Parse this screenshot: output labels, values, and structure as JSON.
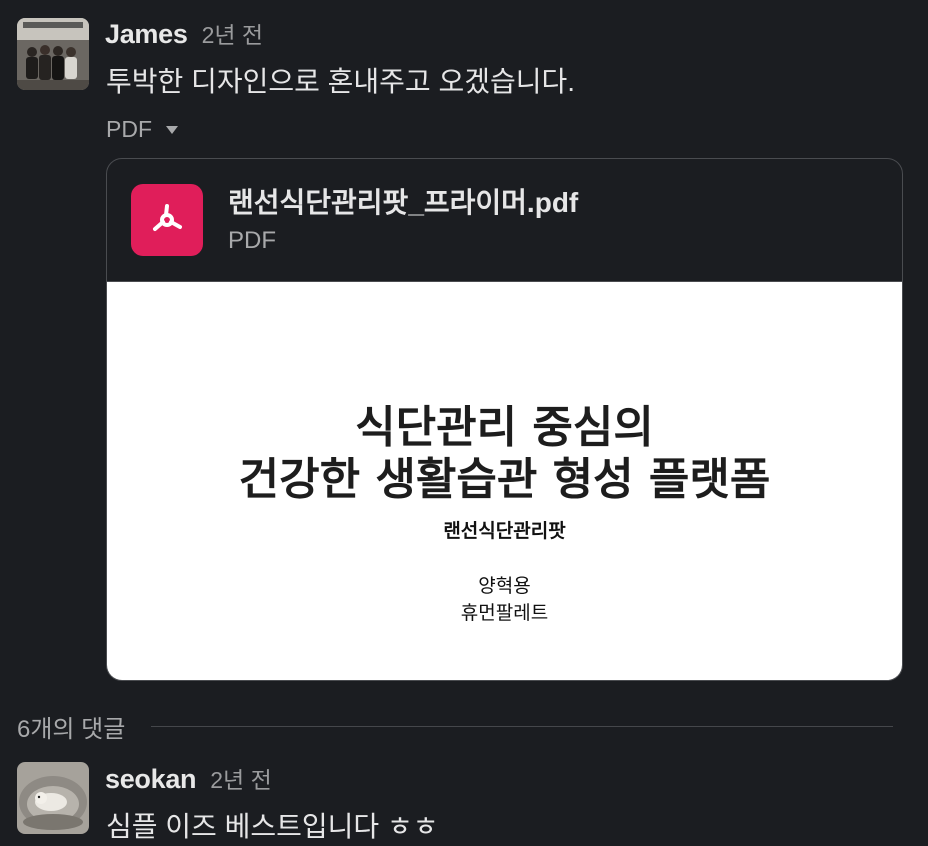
{
  "message": {
    "author": "James",
    "time": "2년 전",
    "text": "투박한 디자인으로 혼내주고 오겠습니다."
  },
  "attachment": {
    "toggle_label": "PDF",
    "file_name": "랜선식단관리팟_프라이머.pdf",
    "file_type": "PDF",
    "icon": "pdf-icon",
    "icon_color": "#e01e5a",
    "preview": {
      "title_line1": "식단관리 중심의",
      "title_line2": "건강한 생활습관 형성 플랫폼",
      "subtitle": "랜선식단관리팟",
      "author": "양혁용",
      "company": "휴먼팔레트"
    }
  },
  "thread": {
    "replies_label": "6개의 댓글"
  },
  "reply": {
    "author": "seokan",
    "time": "2년 전",
    "text": "심플 이즈 베스트입니다 ㅎㅎ"
  }
}
